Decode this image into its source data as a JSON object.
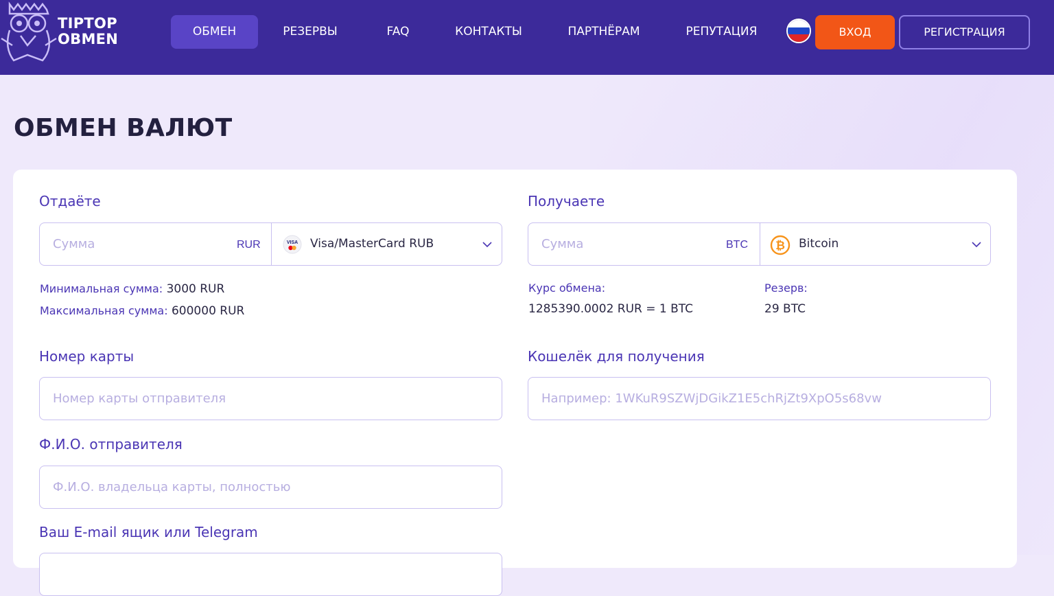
{
  "brand": {
    "line1": "TIPTOP",
    "line2": "OBMEN"
  },
  "nav": [
    {
      "label": "ОБМЕН",
      "active": true
    },
    {
      "label": "РЕЗЕРВЫ",
      "active": false
    },
    {
      "label": "FAQ",
      "active": false
    },
    {
      "label": "КОНТАКТЫ",
      "active": false
    },
    {
      "label": "ПАРТНЁРАМ",
      "active": false
    },
    {
      "label": "РЕПУТАЦИЯ",
      "active": false
    }
  ],
  "header": {
    "flag_icon": "russia-flag-icon",
    "login_label": "ВХОД",
    "register_label": "РЕГИСТРАЦИЯ"
  },
  "page_title": "ОБМЕН ВАЛЮТ",
  "give": {
    "label": "Отдаёте",
    "amount_placeholder": "Сумма",
    "unit": "RUR",
    "currency": "Visa/MasterCard RUB",
    "currency_icon": "visa-mastercard-icon",
    "min_label": "Минимальная сумма:",
    "min_value": "3000 RUR",
    "max_label": "Максимальная сумма:",
    "max_value": "600000 RUR"
  },
  "receive": {
    "label": "Получаете",
    "amount_placeholder": "Сумма",
    "unit": "BTC",
    "currency": "Bitcoin",
    "currency_icon": "bitcoin-icon",
    "rate_label": "Курс обмена:",
    "rate_value": "1285390.0002 RUR = 1 BTC",
    "reserve_label": "Резерв:",
    "reserve_value": "29 BTC"
  },
  "card_number": {
    "label": "Номер карты",
    "placeholder": "Номер карты отправителя"
  },
  "wallet": {
    "label": "Кошелёк для получения",
    "placeholder": "Например: 1WKuR9SZWjDGikZ1E5chRjZt9XpO5s68vw"
  },
  "sender_name": {
    "label": "Ф.И.О. отправителя",
    "placeholder": "Ф.И.О. владельца карты, полностью"
  },
  "contact": {
    "label": "Ваш E-mail ящик или Telegram"
  },
  "colors": {
    "header": "#3c2a9a",
    "accent": "#4a35b4",
    "login": "#f25617",
    "background": "#efe9fb"
  }
}
